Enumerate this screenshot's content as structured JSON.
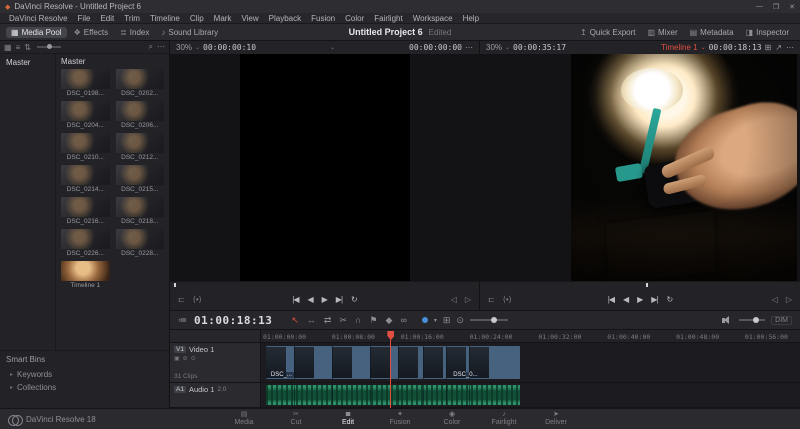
{
  "titlebar": {
    "icon": "◆",
    "title": "DaVinci Resolve - Untitled Project 6",
    "minimize": "—",
    "maximize": "❐",
    "close": "✕"
  },
  "menubar": {
    "items": [
      "DaVinci Resolve",
      "File",
      "Edit",
      "Trim",
      "Timeline",
      "Clip",
      "Mark",
      "View",
      "Playback",
      "Fusion",
      "Color",
      "Fairlight",
      "Workspace",
      "Help"
    ]
  },
  "toolbar": {
    "panels": [
      {
        "icon": "▦",
        "label": "Media Pool",
        "active": true
      },
      {
        "icon": "❖",
        "label": "Effects"
      },
      {
        "icon": "≣",
        "label": "Index"
      },
      {
        "icon": "♪",
        "label": "Sound Library"
      }
    ],
    "project_title": "Untitled Project 6",
    "project_status": "Edited",
    "right": [
      {
        "icon": "↥",
        "label": "Quick Export"
      },
      {
        "icon": "▥",
        "label": "Mixer"
      },
      {
        "icon": "▤",
        "label": "Metadata"
      },
      {
        "icon": "◨",
        "label": "Inspector"
      }
    ]
  },
  "media_pool": {
    "left_icons": [
      {
        "name": "thumbnail-view-icon",
        "glyph": "▦"
      },
      {
        "name": "list-view-icon",
        "glyph": "≡"
      },
      {
        "name": "sort-icon",
        "glyph": "⇅"
      }
    ],
    "right_icons": [
      {
        "name": "search-icon",
        "glyph": "⌕"
      },
      {
        "name": "more-options-icon",
        "glyph": "⋯"
      }
    ],
    "bins": [
      "Master"
    ],
    "grid_header": "Master",
    "clips": [
      {
        "name": "DSC_0198..."
      },
      {
        "name": "DSC_0202..."
      },
      {
        "name": "DSC_0204..."
      },
      {
        "name": "DSC_0206..."
      },
      {
        "name": "DSC_0210..."
      },
      {
        "name": "DSC_0212..."
      },
      {
        "name": "DSC_0214..."
      },
      {
        "name": "DSC_0215..."
      },
      {
        "name": "DSC_0216..."
      },
      {
        "name": "DSC_0218..."
      },
      {
        "name": "DSC_0226..."
      },
      {
        "name": "DSC_0228..."
      },
      {
        "name": "Timeline 1",
        "warm": true
      }
    ],
    "smart_bins_title": "Smart Bins",
    "smart_bins": [
      {
        "label": "Keywords"
      },
      {
        "label": "Collections"
      }
    ]
  },
  "source_viewer": {
    "zoom": "30%",
    "caret": "⌄",
    "timecode": "00:00:00:10",
    "right_timecode": "00:00:00:00",
    "menu": "⋯"
  },
  "timeline_viewer": {
    "zoom": "30%",
    "caret": "⌄",
    "timecode": "00:00:35:17",
    "timeline_name": "Timeline 1",
    "current_timecode": "00:00:18:13",
    "icons": [
      {
        "name": "multicam-grid-icon",
        "glyph": "⊞"
      },
      {
        "name": "expand-viewer-icon",
        "glyph": "↗"
      },
      {
        "name": "viewer-options-icon",
        "glyph": "⋯"
      }
    ]
  },
  "transport": {
    "left_icon": "⊏",
    "buttons": [
      {
        "name": "goto-first-frame-button",
        "glyph": "|◀"
      },
      {
        "name": "step-back-button",
        "glyph": "◀"
      },
      {
        "name": "play-button",
        "glyph": "▶"
      },
      {
        "name": "goto-last-frame-button",
        "glyph": "▶|"
      },
      {
        "name": "loop-button",
        "glyph": "↻"
      }
    ],
    "right_icons": [
      {
        "name": "previous-edit-icon",
        "glyph": "◁"
      },
      {
        "name": "next-edit-icon",
        "glyph": "▷"
      }
    ]
  },
  "timeline": {
    "options_icon": "≔",
    "timecode": "01:00:18:13",
    "tools": [
      {
        "name": "select-tool",
        "glyph": "↖",
        "accent": true
      },
      {
        "name": "trim-edit-tool",
        "glyph": "↔"
      },
      {
        "name": "dynamic-trim-tool",
        "glyph": "⇄"
      },
      {
        "name": "razor-tool",
        "glyph": "✂"
      },
      {
        "name": "snapping-icon",
        "glyph": "∩"
      },
      {
        "name": "flag-icon",
        "glyph": "⚑"
      },
      {
        "name": "marker-icon",
        "glyph": "◆"
      },
      {
        "name": "link-clips-icon",
        "glyph": "∞"
      }
    ],
    "marker_caret": "▾",
    "zoom_icons": [
      {
        "name": "full-extent-zoom-icon",
        "glyph": "⊞"
      },
      {
        "name": "detail-zoom-icon",
        "glyph": "⊙"
      }
    ],
    "dim_label": "DIM",
    "ruler_labels": [
      "01:00:00:00",
      "01:00:08:00",
      "01:00:16:00",
      "01:00:24:00",
      "01:00:32:00",
      "01:00:40:00",
      "01:00:48:00",
      "01:00:56:00"
    ],
    "video_track": {
      "badge": "V1",
      "name": "Video 1",
      "clip_count": "31 Clips"
    },
    "audio_track": {
      "badge": "A1",
      "name": "Audio 1",
      "format": "2.0"
    },
    "clip_labels": [
      {
        "text": "DSC_..."
      },
      {
        "text": "DSC_0..."
      }
    ]
  },
  "bottombar": {
    "version": "DaVinci Resolve 18",
    "pages": [
      {
        "icon": "▤",
        "label": "Media"
      },
      {
        "icon": "✂",
        "label": "Cut"
      },
      {
        "icon": "≣",
        "label": "Edit",
        "active": true
      },
      {
        "icon": "✦",
        "label": "Fusion"
      },
      {
        "icon": "◉",
        "label": "Color"
      },
      {
        "icon": "♪",
        "label": "Fairlight"
      },
      {
        "icon": "➤",
        "label": "Deliver"
      }
    ]
  }
}
